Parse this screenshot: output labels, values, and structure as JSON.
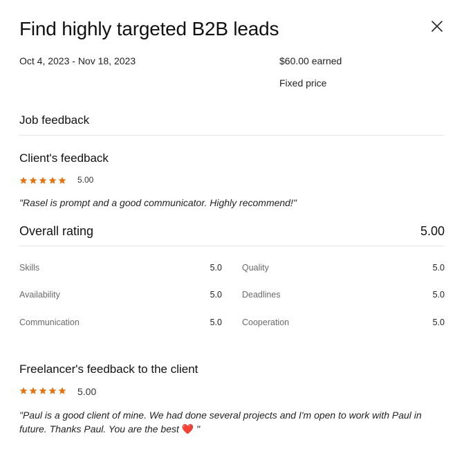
{
  "header": {
    "title": "Find highly targeted B2B leads",
    "close_icon": "close-icon"
  },
  "contract": {
    "dates": "Oct 4, 2023 - Nov 18, 2023",
    "earned": "$60.00 earned",
    "price_type": "Fixed price"
  },
  "job_feedback": {
    "heading": "Job feedback"
  },
  "client_feedback": {
    "heading": "Client's feedback",
    "stars": 5,
    "score": "5.00",
    "comment": "\"Rasel is prompt and a good communicator. Highly recommend!\""
  },
  "overall": {
    "label": "Overall rating",
    "value": "5.00",
    "ratings": [
      {
        "label": "Skills",
        "value": "5.0"
      },
      {
        "label": "Quality",
        "value": "5.0"
      },
      {
        "label": "Availability",
        "value": "5.0"
      },
      {
        "label": "Deadlines",
        "value": "5.0"
      },
      {
        "label": "Communication",
        "value": "5.0"
      },
      {
        "label": "Cooperation",
        "value": "5.0"
      }
    ]
  },
  "freelancer_feedback": {
    "heading": "Freelancer's feedback to the client",
    "stars": 5,
    "score": "5.00",
    "comment_line1": "\"Paul is a good client of mine. We had done several projects and I'm open to work with Paul in",
    "comment_line2": "future. Thanks Paul. You are the best",
    "comment_emoji": "❤️",
    "comment_end": " \""
  },
  "colors": {
    "star": "#e5730f",
    "divider": "#e4e6e8",
    "heart": "#e3242b"
  }
}
